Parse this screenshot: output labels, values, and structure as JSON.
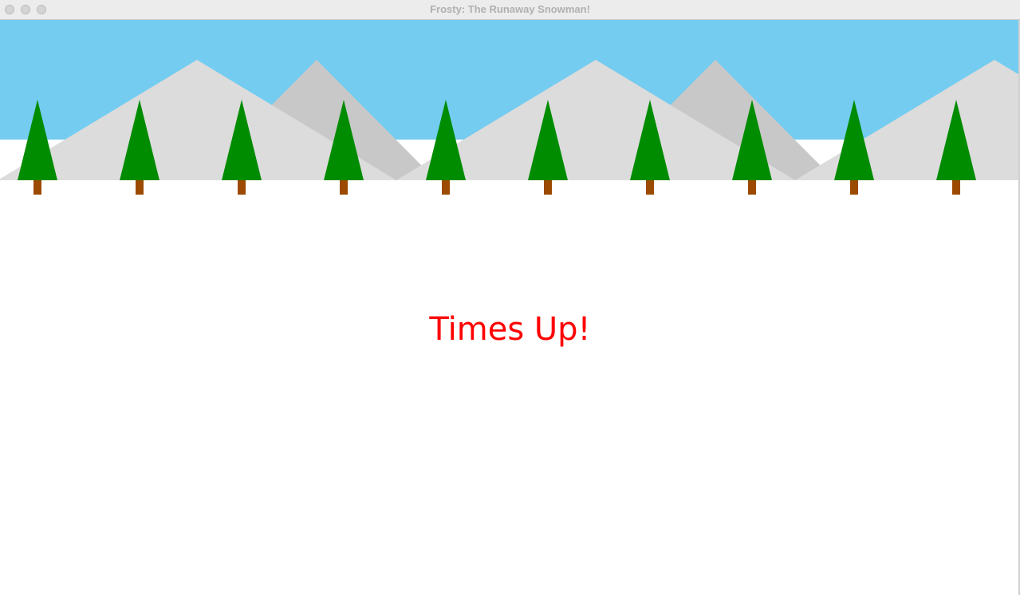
{
  "window": {
    "title": "Frosty: The Runaway Snowman!"
  },
  "game": {
    "status_message": "Times Up!",
    "colors": {
      "sky": "#74ccf0",
      "snow": "#ffffff",
      "mountain_front": "#dcdcdc",
      "mountain_back": "#c8c8c8",
      "tree_foliage": "#008c00",
      "tree_trunk": "#9c4a00",
      "message": "#ff0000"
    },
    "tree_count": 10
  }
}
